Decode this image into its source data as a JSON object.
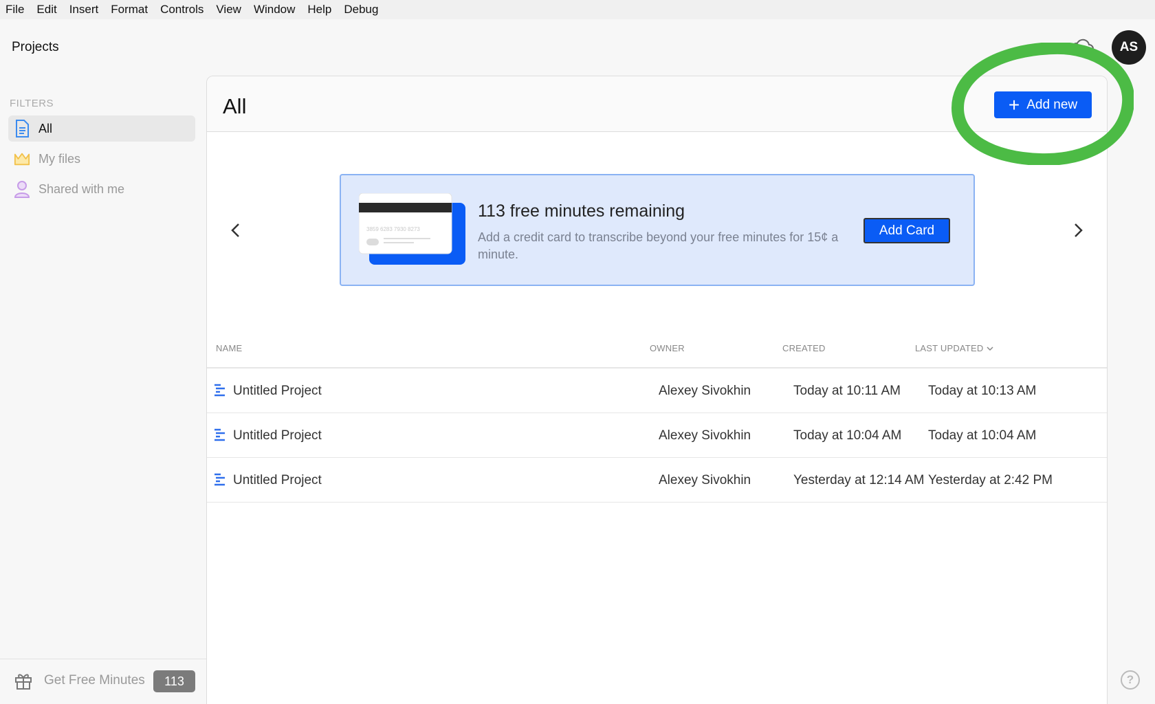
{
  "menu": [
    "File",
    "Edit",
    "Insert",
    "Format",
    "Controls",
    "View",
    "Window",
    "Help",
    "Debug"
  ],
  "header": {
    "app_title": "Projects",
    "avatar_initials": "AS"
  },
  "sidebar": {
    "filters_label": "FILTERS",
    "items": [
      {
        "label": "All",
        "icon": "document-icon",
        "active": true
      },
      {
        "label": "My files",
        "icon": "crown-icon",
        "active": false
      },
      {
        "label": "Shared with me",
        "icon": "person-icon",
        "active": false
      }
    ],
    "get_free_minutes_label": "Get Free Minutes",
    "free_minutes_badge": "113"
  },
  "main": {
    "title": "All",
    "add_new_label": "Add new",
    "banner": {
      "card_number": "3859 6283 7930 8273",
      "title": "113 free minutes remaining",
      "description": "Add a credit card to transcribe beyond your free minutes for 15¢ a minute.",
      "button_label": "Add Card"
    },
    "table": {
      "columns": [
        "NAME",
        "OWNER",
        "CREATED",
        "LAST UPDATED"
      ],
      "rows": [
        {
          "name": "Untitled Project",
          "owner": "Alexey Sivokhin",
          "created": "Today at 10:11 AM",
          "updated": "Today at 10:13 AM"
        },
        {
          "name": "Untitled Project",
          "owner": "Alexey Sivokhin",
          "created": "Today at 10:04 AM",
          "updated": "Today at 10:04 AM"
        },
        {
          "name": "Untitled Project",
          "owner": "Alexey Sivokhin",
          "created": "Yesterday at 12:14 AM",
          "updated": "Yesterday at 2:42 PM"
        }
      ]
    }
  },
  "colors": {
    "accent": "#0a5cf5",
    "annotation": "#4cbb45",
    "banner_bg": "#dfe9fc"
  }
}
